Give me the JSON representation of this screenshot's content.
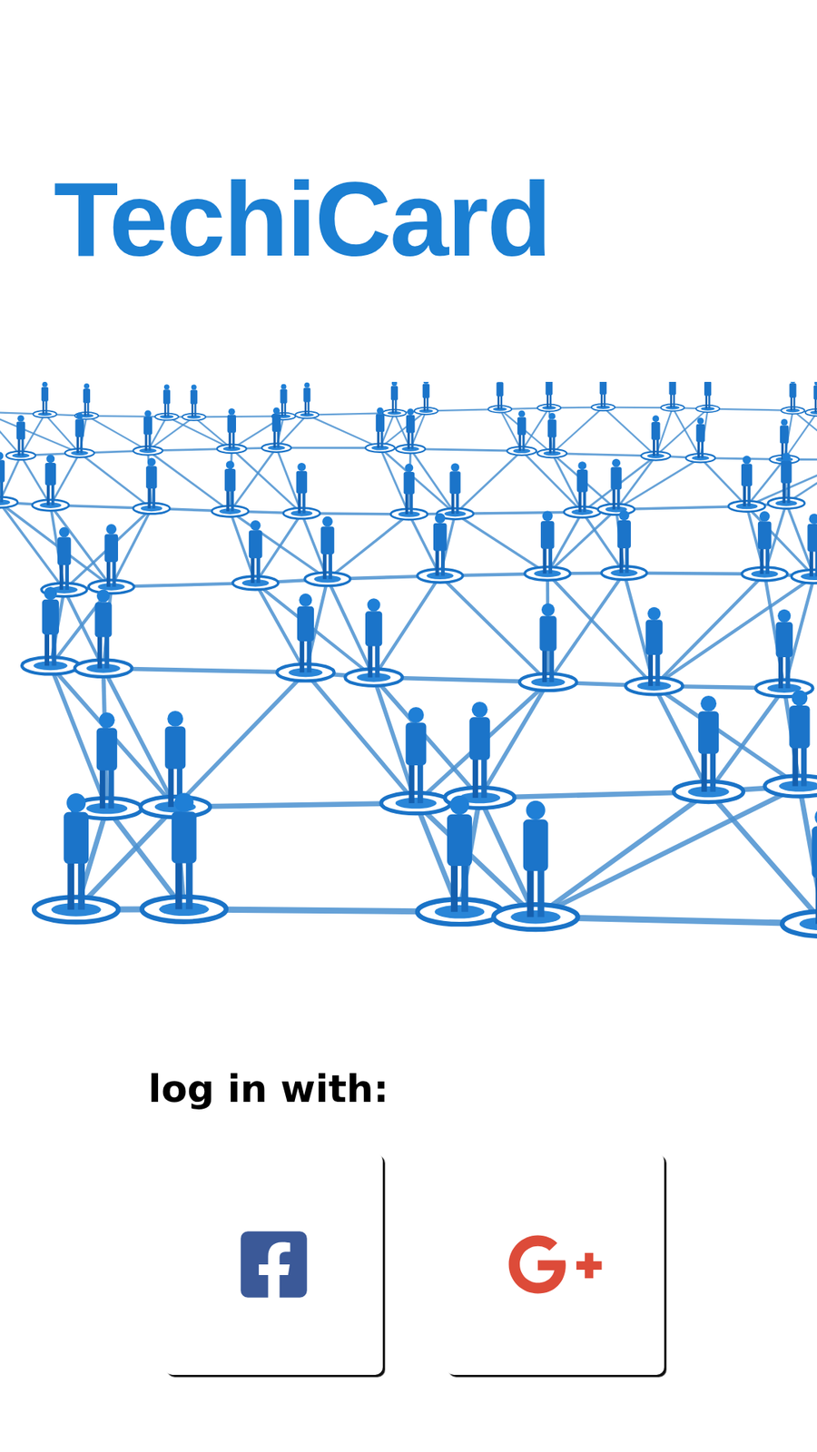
{
  "app": {
    "title": "TechiCard"
  },
  "login": {
    "label": "log in with:",
    "providers": [
      {
        "kind": "facebook",
        "color": "#3b5998"
      },
      {
        "kind": "google-plus",
        "color": "#dd4b39"
      }
    ]
  }
}
